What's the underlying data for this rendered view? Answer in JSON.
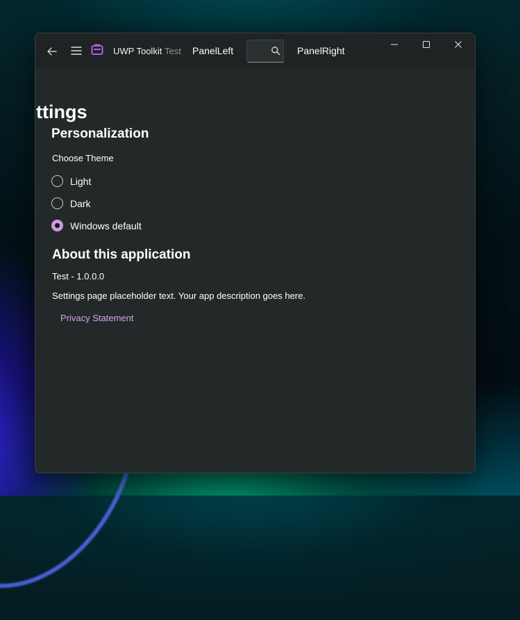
{
  "titlebar": {
    "app_title": "UWP Toolkit",
    "app_subtitle": "Test",
    "panel_left": "PanelLeft",
    "panel_right": "PanelRight",
    "search_value": ""
  },
  "settings": {
    "page_title": "ettings",
    "personalization_header": "Personalization",
    "choose_theme_label": "Choose Theme",
    "theme_options": [
      {
        "label": "Light",
        "selected": false
      },
      {
        "label": "Dark",
        "selected": false
      },
      {
        "label": "Windows default",
        "selected": true
      }
    ],
    "about_header": "About this application",
    "version_text": "Test - 1.0.0.0",
    "description": "Settings page placeholder text.  Your app description goes here.",
    "privacy_link": "Privacy Statement"
  },
  "colors": {
    "accent": "#c99ae0",
    "link": "#d4a6ec",
    "window_bg": "#232829",
    "titlebar_bg": "#1f2324",
    "app_icon": "#a555d8"
  },
  "icons": [
    "back-arrow-icon",
    "hamburger-menu-icon",
    "app-icon",
    "search-icon",
    "minimize-icon",
    "maximize-icon",
    "close-icon"
  ]
}
